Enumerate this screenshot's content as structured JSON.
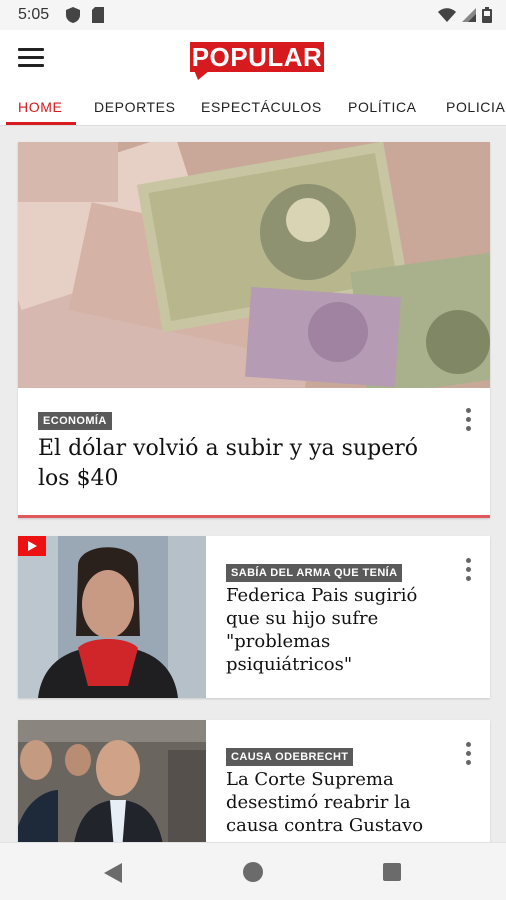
{
  "status_bar": {
    "time": "5:05",
    "icons": [
      "shield-icon",
      "sd-card-icon",
      "wifi-icon",
      "signal-icon",
      "battery-icon"
    ]
  },
  "app_bar": {
    "logo_text": "POPULAR",
    "brand_color": "#d71a1e"
  },
  "tabs": [
    {
      "label": "HOME",
      "active": true
    },
    {
      "label": "DEPORTES",
      "active": false
    },
    {
      "label": "ESPECTÁCULOS",
      "active": false
    },
    {
      "label": "POLÍTICA",
      "active": false
    },
    {
      "label": "POLICIALES",
      "active": false
    }
  ],
  "articles": [
    {
      "tag": "ECONOMÍA",
      "title": "El dólar volvió a subir y ya superó los $40",
      "image": "money-banknotes-photo"
    },
    {
      "tag": "SABÍA DEL ARMA QUE TENÍA",
      "title": "Federica Pais sugirió que su hijo sufre \"problemas psiquiátricos\"",
      "image": "woman-portrait-photo",
      "video": true
    },
    {
      "tag": "CAUSA ODEBRECHT",
      "title": "La Corte Suprema desestimó reabrir la causa contra Gustavo",
      "image": "men-group-photo"
    }
  ],
  "nav_bar": {
    "icons": [
      "back-icon",
      "home-icon",
      "recents-icon"
    ]
  }
}
